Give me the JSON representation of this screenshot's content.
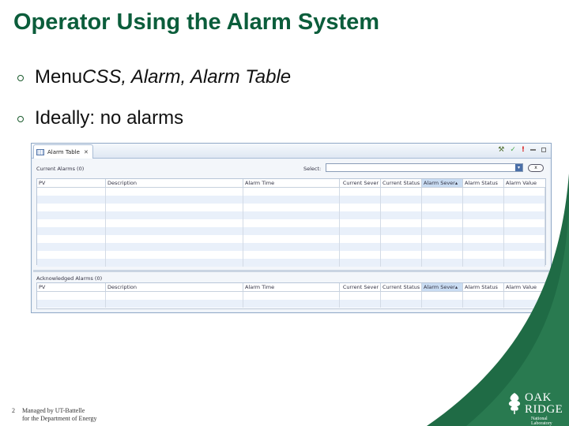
{
  "slide": {
    "title": "Operator Using the Alarm System",
    "bullets": [
      {
        "parts": [
          {
            "text": "Menu ",
            "italic": false
          },
          {
            "text": "CSS, Alarm, Alarm Table",
            "italic": true
          }
        ]
      },
      {
        "parts": [
          {
            "text": "Ideally: no alarms",
            "italic": false
          }
        ]
      }
    ]
  },
  "view": {
    "tab_label": "Alarm Table",
    "tab_close": "✕",
    "toolbar_icons": [
      "acknowledge-icon",
      "check-icon",
      "exclamation-icon",
      "minimize-icon",
      "maximize-icon"
    ],
    "current_alarms_label": "Current Alarms (0)",
    "select_label": "Select:",
    "select_value": "",
    "clear_button_label": "x",
    "acknowledged_alarms_label": "Acknowledged Alarms (0)",
    "columns": [
      "PV",
      "Description",
      "Alarm Time",
      "Current Sever",
      "Current Status",
      "Alarm Sever▴",
      "Alarm Status",
      "Alarm Value"
    ],
    "sorted_column_index": 5
  },
  "footer": {
    "page_number": "2",
    "line1": "Managed by UT-Battelle",
    "line2": "for the Department of Energy"
  },
  "logo": {
    "line1": "OAK",
    "line2": "RIDGE",
    "line3": "National Laboratory"
  },
  "colors": {
    "title": "#0b5d3b",
    "swoosh": "#1f6b45",
    "sorted_header": "#c9dcf2"
  }
}
